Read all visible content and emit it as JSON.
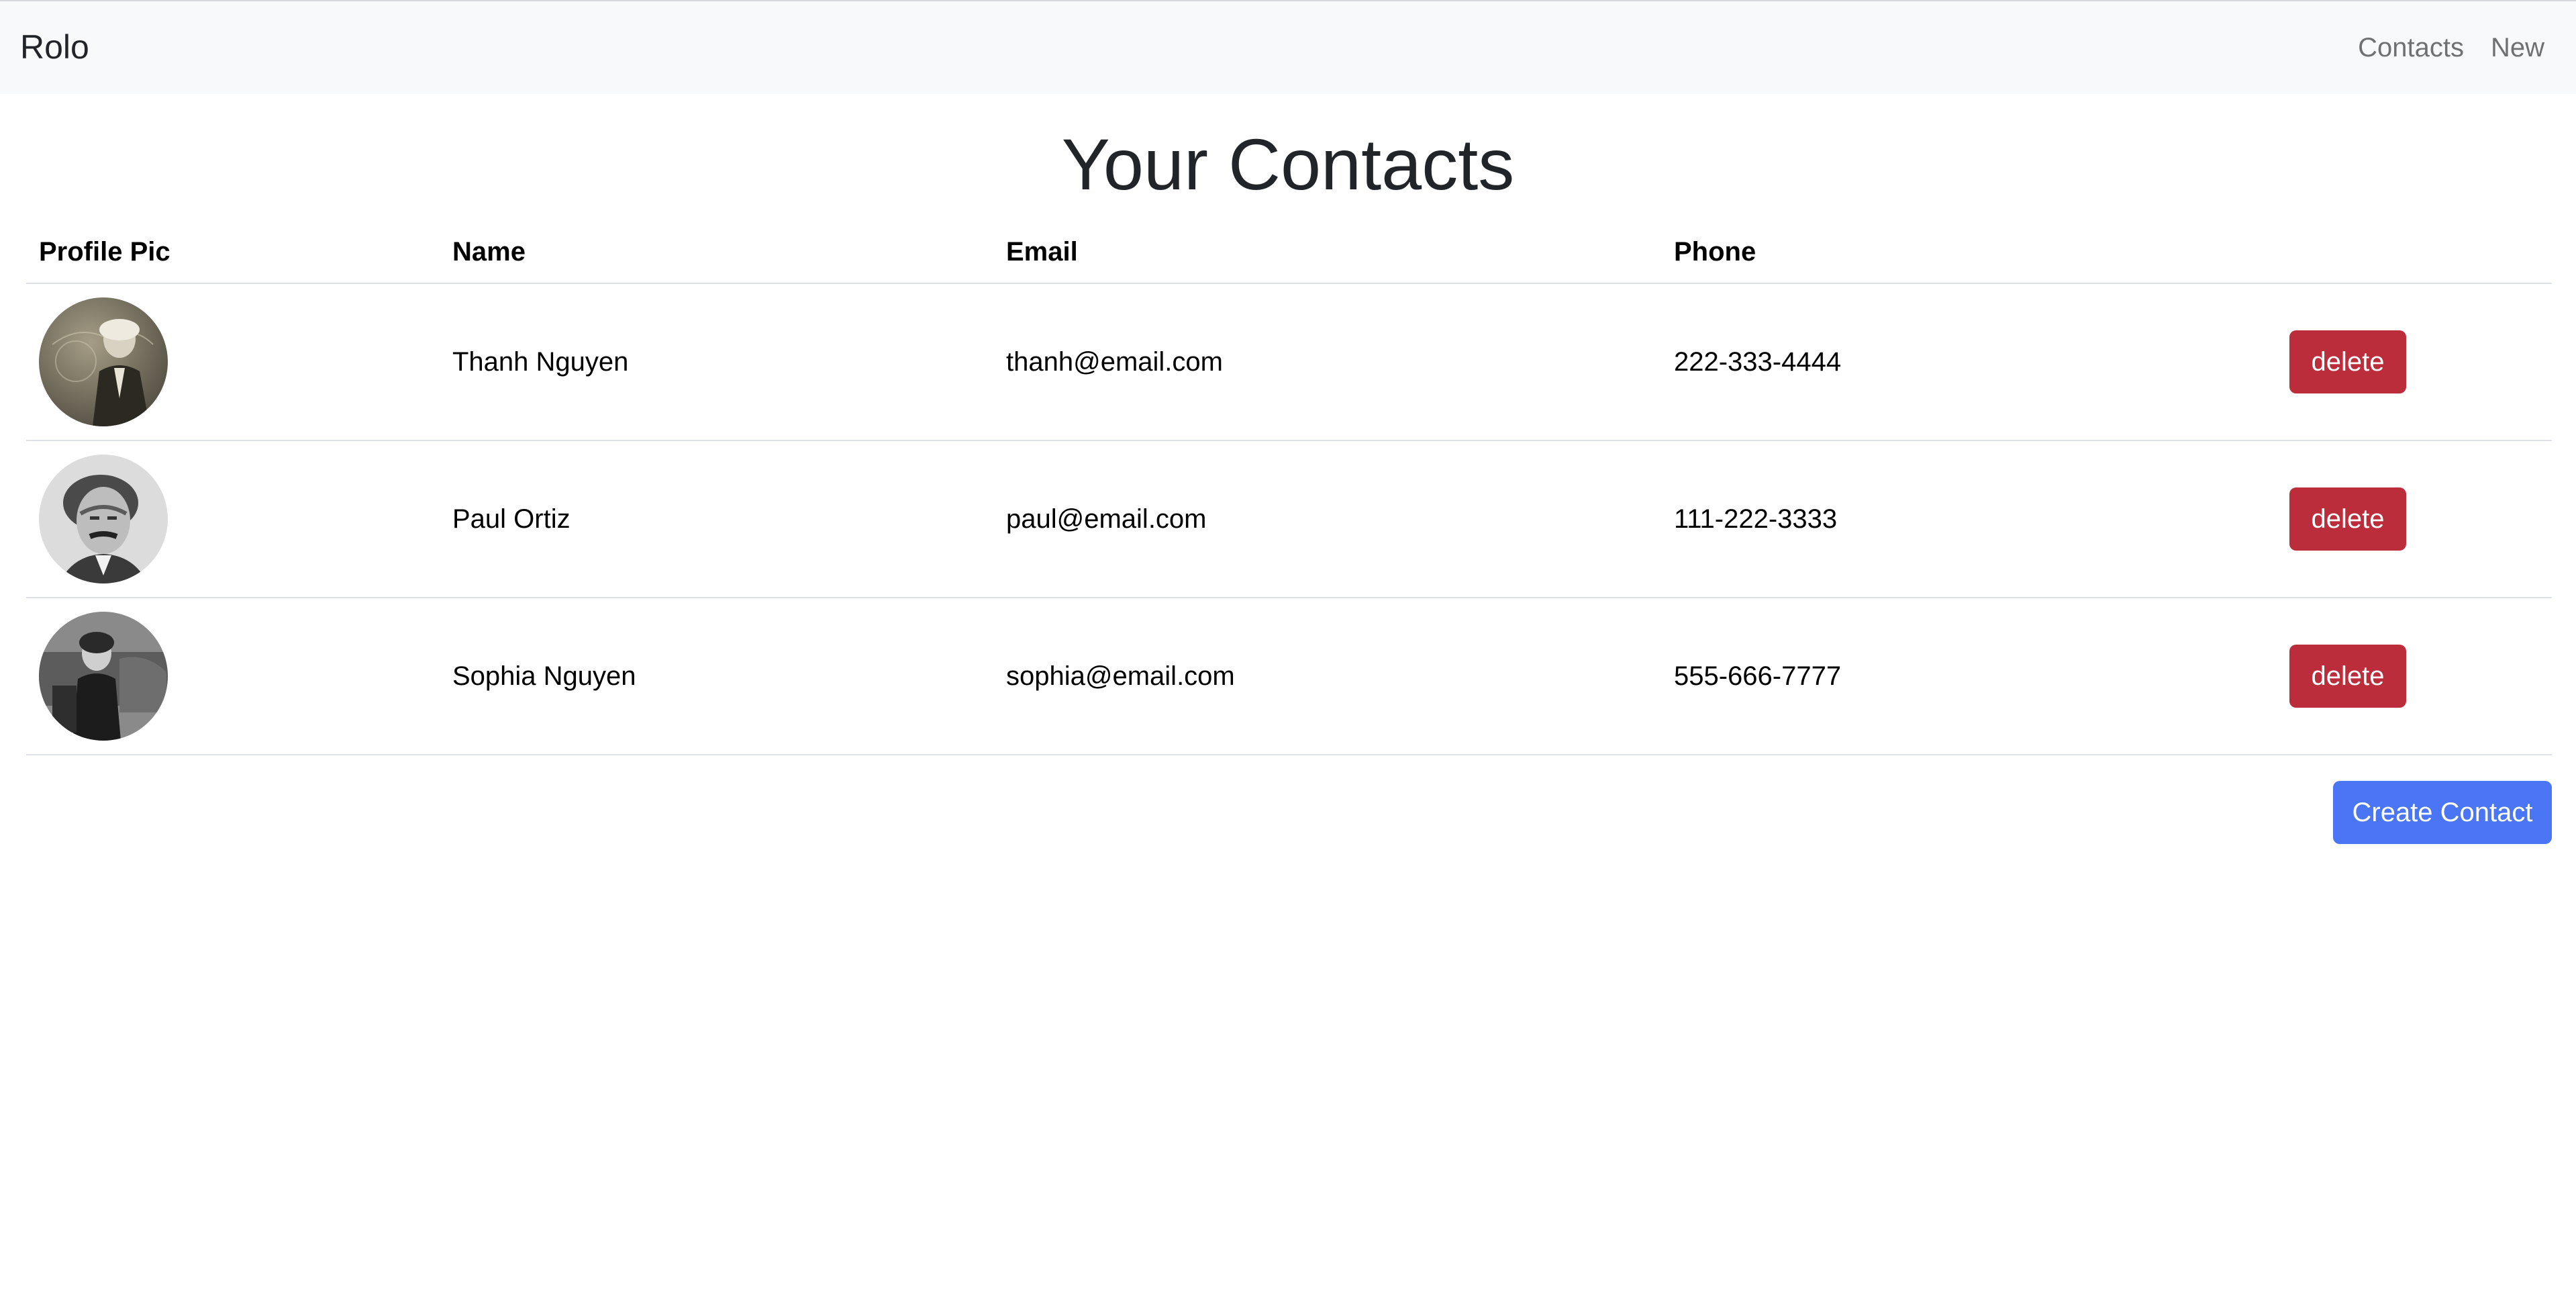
{
  "navbar": {
    "brand": "Rolo",
    "links": [
      "Contacts",
      "New"
    ]
  },
  "page_title": "Your Contacts",
  "table": {
    "headers": [
      "Profile Pic",
      "Name",
      "Email",
      "Phone"
    ],
    "rows": [
      {
        "name": "Thanh Nguyen",
        "email": "thanh@email.com",
        "phone": "222-333-4444",
        "action": "delete"
      },
      {
        "name": "Paul Ortiz",
        "email": "paul@email.com",
        "phone": "111-222-3333",
        "action": "delete"
      },
      {
        "name": "Sophia Nguyen",
        "email": "sophia@email.com",
        "phone": "555-666-7777",
        "action": "delete"
      }
    ]
  },
  "create_button": "Create Contact",
  "colors": {
    "navbar_bg": "#f8f9fa",
    "delete_button": "#bb2d3b",
    "create_button": "#4a76f5"
  }
}
